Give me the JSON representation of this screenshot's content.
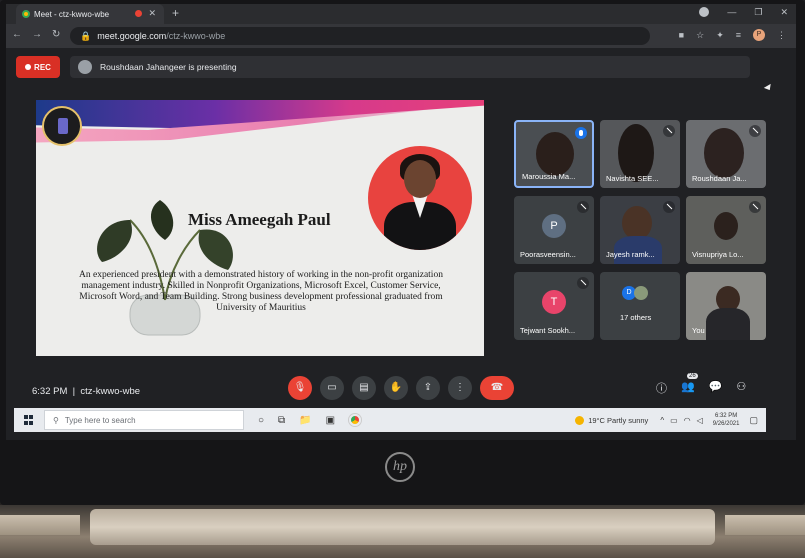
{
  "browser": {
    "tab_title": "Meet - ctz-kwwo-wbe",
    "url_host": "meet.google.com",
    "url_path": "/ctz-kwwo-wbe",
    "profile_initial": "P"
  },
  "meet": {
    "rec_label": "REC",
    "presenting_text": "Roushdaan Jahangeer is presenting",
    "time": "6:32 PM",
    "meeting_code": "ctz-kwwo-wbe",
    "participants_count": "26"
  },
  "slide": {
    "name": "Miss Ameegah Paul",
    "bio": "An experienced president with a demonstrated history of working in the non-profit organization management industry. Skilled in Nonprofit Organizations, Microsoft Excel, Customer Service, Microsoft Word, and Team Building. Strong business development professional graduated from University of Mauritius"
  },
  "participants": [
    {
      "name": "Maroussia Ma...",
      "type": "video",
      "speaking": true
    },
    {
      "name": "Navishta SEE...",
      "type": "video"
    },
    {
      "name": "Roushdaan Ja...",
      "type": "video"
    },
    {
      "name": "Poorasveensin...",
      "type": "avatar",
      "initial": "P",
      "color": "#5f6f82"
    },
    {
      "name": "Jayesh ramk...",
      "type": "video"
    },
    {
      "name": "Visnupriya Lo...",
      "type": "video"
    },
    {
      "name": "Tejwant Sookh...",
      "type": "avatar",
      "initial": "T",
      "color": "#e8446a"
    },
    {
      "name": "17 others",
      "type": "others",
      "initial": "D"
    },
    {
      "name": "You",
      "type": "video"
    }
  ],
  "taskbar": {
    "search_placeholder": "Type here to search",
    "weather": "19°C  Partly sunny",
    "clock_time": "6:32 PM",
    "clock_date": "9/26/2021"
  },
  "brand": {
    "laptop_logo": "hp"
  }
}
